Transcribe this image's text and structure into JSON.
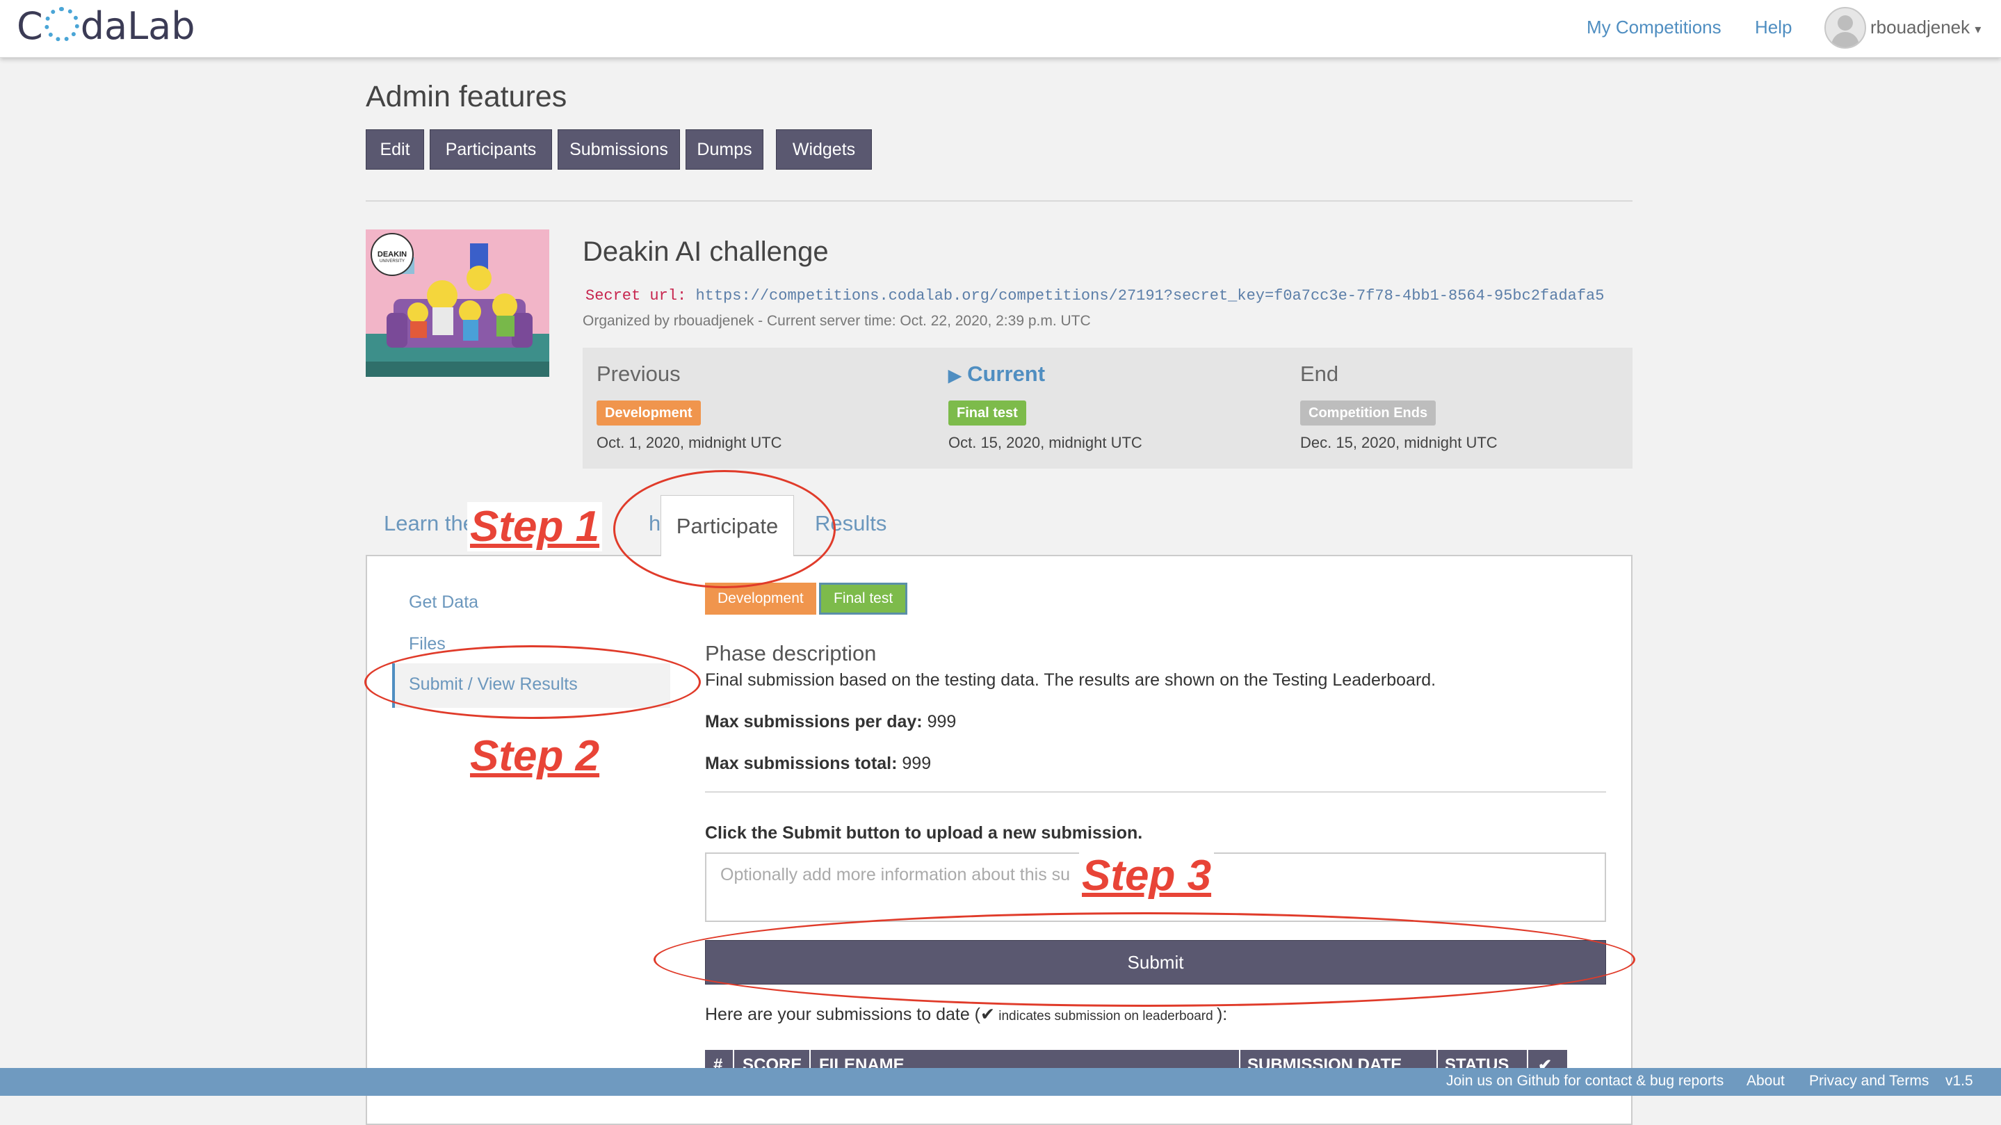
{
  "nav": {
    "logo_left": "C",
    "logo_right": "daLab",
    "my_competitions": "My Competitions",
    "help": "Help",
    "username": "rbouadjenek",
    "caret": "▾"
  },
  "admin": {
    "title": "Admin features",
    "buttons": [
      "Edit",
      "Participants",
      "Submissions",
      "Dumps",
      "Widgets"
    ]
  },
  "competition": {
    "title": "Deakin AI challenge",
    "secret_label": "Secret url:",
    "secret_url": "https://competitions.codalab.org/competitions/27191?secret_key=f0a7cc3e-7f78-4bb1-8564-95bc2fadafa5",
    "organized": "Organized by rbouadjenek - Current server time: Oct. 22, 2020, 2:39 p.m. UTC",
    "thumbnail_badge": "DEAKIN",
    "thumbnail_sub": "UNIVERSITY"
  },
  "phases": {
    "previous": {
      "label": "Previous",
      "badge": "Development",
      "date": "Oct. 1, 2020, midnight UTC"
    },
    "current": {
      "marker": "▶",
      "label": "Current",
      "badge": "Final test",
      "date": "Oct. 15, 2020, midnight UTC"
    },
    "end": {
      "label": "End",
      "badge": "Competition Ends",
      "date": "Dec. 15, 2020, midnight UTC"
    }
  },
  "tabs": {
    "learn_prefix": "Learn the",
    "learn_suffix": "hases",
    "participate": "Participate",
    "results_prefix": "R",
    "results_suffix": "esults"
  },
  "sidebar": {
    "items": [
      "Get Data",
      "Files",
      "Submit / View Results"
    ]
  },
  "participate": {
    "phase_buttons": [
      "Development",
      "Final test"
    ],
    "phase_desc_title": "Phase description",
    "phase_desc": "Final submission based on the testing data. The results are shown on the Testing Leaderboard.",
    "max_day_label": "Max submissions per day:",
    "max_day_value": "999",
    "max_total_label": "Max submissions total:",
    "max_total_value": "999",
    "submit_prompt": "Click the Submit button to upload a new submission.",
    "textarea_placeholder": "Optionally add more information about this su",
    "submit_button": "Submit",
    "submissions_note_prefix": "Here are your submissions to date (",
    "submissions_note_check": "✔",
    "submissions_note_small": " indicates submission on leaderboard ",
    "submissions_note_suffix": "):"
  },
  "table": {
    "headers": [
      "#",
      "SCORE",
      "FILENAME",
      "SUBMISSION DATE",
      "STATUS",
      "✔"
    ]
  },
  "annotations": {
    "step1": "Step 1",
    "step2": "Step 2",
    "step3": "Step 3"
  },
  "footer": {
    "links": [
      "Join us on Github for contact & bug reports",
      "About",
      "Privacy and Terms",
      "v1.5"
    ]
  },
  "colors": {
    "nav_link": "#4f8ec1",
    "admin_button": "#5a5870",
    "development": "#f0954d",
    "final_test": "#7dbb4b",
    "competition_ends": "#bdbdbd",
    "annotation": "#e84437",
    "footer": "#6f9ac0"
  }
}
